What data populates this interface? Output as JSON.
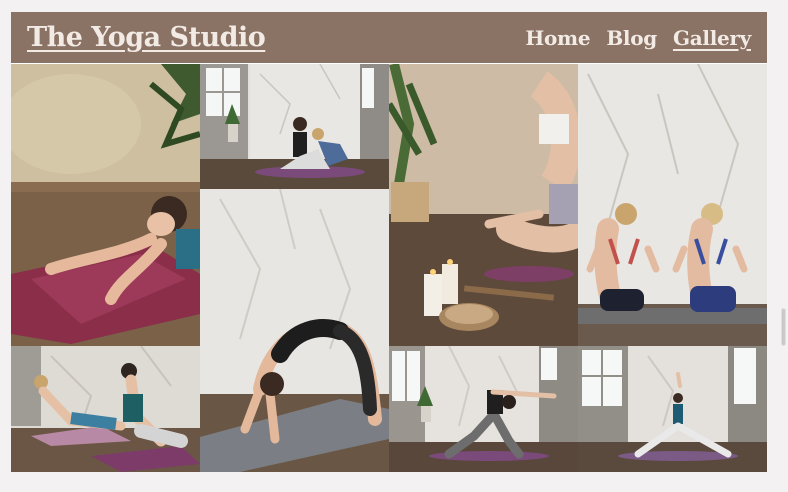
{
  "header": {
    "title": "The Yoga Studio",
    "nav": [
      {
        "label": "Home",
        "active": false
      },
      {
        "label": "Blog",
        "active": false
      },
      {
        "label": "Gallery",
        "active": true
      }
    ]
  },
  "colors": {
    "header_bg": "#8a7264",
    "header_text": "#f2ebe5",
    "page_bg": "#f3f1f1"
  },
  "gallery": {
    "photos": [
      {
        "name": "woman-stretching-on-purple-mat"
      },
      {
        "name": "women-partner-yoga-on-floor"
      },
      {
        "name": "meditation-with-candles"
      },
      {
        "name": "two-women-namaste-back-pose"
      },
      {
        "name": "women-side-stretch-pose"
      },
      {
        "name": "woman-wheel-pose-on-gray-mat"
      },
      {
        "name": "woman-reverse-warrior-pose"
      },
      {
        "name": "woman-seated-arm-raise-pose"
      }
    ]
  }
}
